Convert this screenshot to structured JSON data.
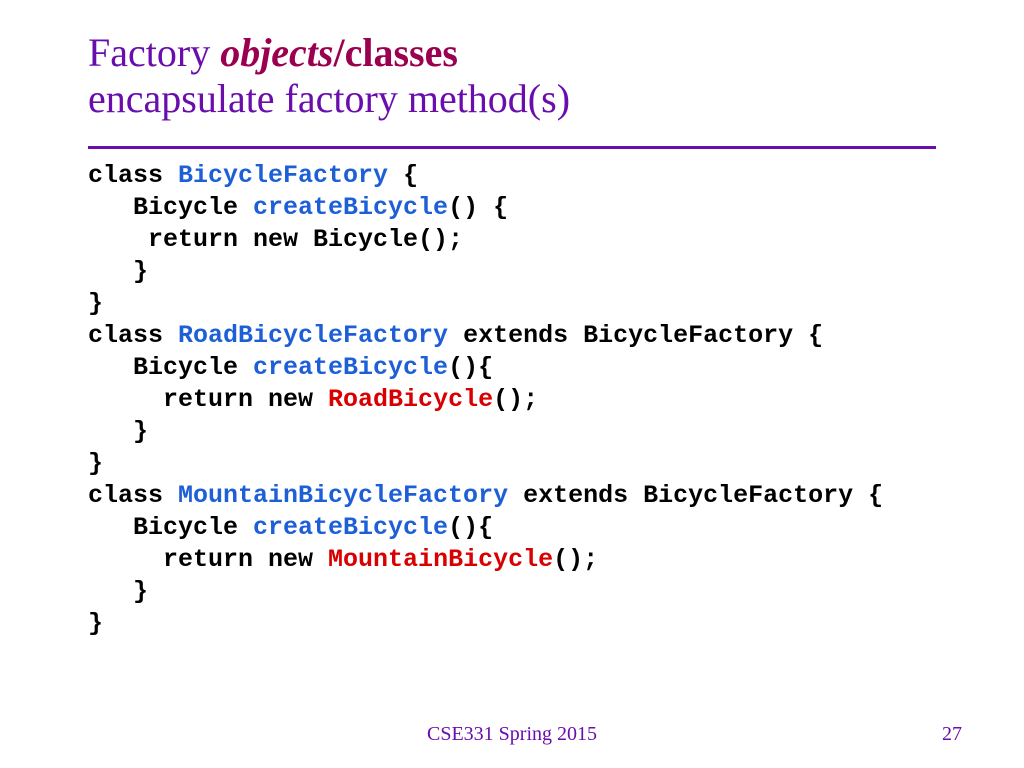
{
  "title": {
    "p1": "Factory ",
    "p2": "objects",
    "p3": "/",
    "p4": "classes",
    "line2": "encapsulate factory method(s)"
  },
  "code": {
    "l1_a": "class ",
    "l1_b": "BicycleFactory",
    "l1_c": " {",
    "l2_a": "   Bicycle ",
    "l2_b": "createBicycle",
    "l2_c": "() {",
    "l3": "    return new Bicycle();",
    "l4": "   }",
    "l5": "}",
    "l6_a": "class ",
    "l6_b": "RoadBicycleFactory",
    "l6_c": " extends BicycleFactory {",
    "l7_a": "   Bicycle ",
    "l7_b": "createBicycle",
    "l7_c": "(){",
    "l8_a": "     return new ",
    "l8_b": "RoadBicycle",
    "l8_c": "();",
    "l9": "   }",
    "l10": "}",
    "l11_a": "class ",
    "l11_b": "MountainBicycleFactory",
    "l11_c": " extends BicycleFactory {",
    "l12_a": "   Bicycle ",
    "l12_b": "createBicycle",
    "l12_c": "(){",
    "l13_a": "     return new ",
    "l13_b": "MountainBicycle",
    "l13_c": "();",
    "l14": "   }",
    "l15": "}"
  },
  "footer": {
    "course": "CSE331 Spring 2015",
    "page": "27"
  }
}
